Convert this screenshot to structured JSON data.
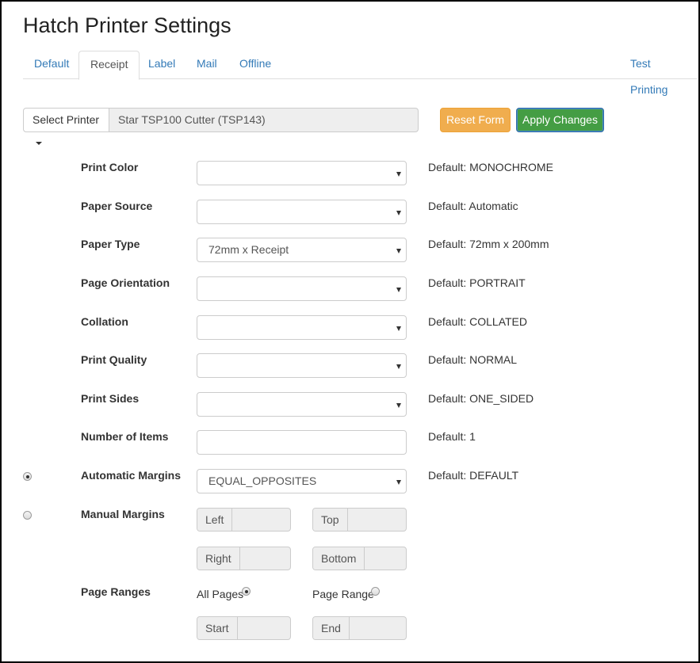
{
  "title": "Hatch Printer Settings",
  "tabs": [
    {
      "label": "Default"
    },
    {
      "label": "Receipt"
    },
    {
      "label": "Label"
    },
    {
      "label": "Mail"
    },
    {
      "label": "Offline"
    }
  ],
  "test_printing": "Test Printing",
  "active_tab": "Receipt",
  "printer": {
    "select_label": "Select Printer",
    "name": "Star TSP100 Cutter (TSP143)"
  },
  "buttons": {
    "reset": "Reset Form",
    "apply": "Apply Changes"
  },
  "fields": {
    "print_color": {
      "label": "Print Color",
      "value": "",
      "default": "Default: MONOCHROME"
    },
    "paper_source": {
      "label": "Paper Source",
      "value": "",
      "default": "Default: Automatic"
    },
    "paper_type": {
      "label": "Paper Type",
      "value": "72mm x Receipt",
      "default": "Default: 72mm x 200mm"
    },
    "page_orientation": {
      "label": "Page Orientation",
      "value": "",
      "default": "Default: PORTRAIT"
    },
    "collation": {
      "label": "Collation",
      "value": "",
      "default": "Default: COLLATED"
    },
    "print_quality": {
      "label": "Print Quality",
      "value": "",
      "default": "Default: NORMAL"
    },
    "print_sides": {
      "label": "Print Sides",
      "value": "",
      "default": "Default: ONE_SIDED"
    },
    "number_of_items": {
      "label": "Number of Items",
      "value": "",
      "default": "Default: 1"
    },
    "automatic_margins": {
      "label": "Automatic Margins",
      "value": "EQUAL_OPPOSITES",
      "default": "Default: DEFAULT",
      "selected": true
    },
    "manual_margins": {
      "label": "Manual Margins",
      "selected": false,
      "left": "Left",
      "top": "Top",
      "right": "Right",
      "bottom": "Bottom"
    },
    "page_ranges": {
      "label": "Page Ranges",
      "all_pages": "All Pages",
      "page_range": "Page Range",
      "all_pages_selected": true,
      "start": "Start",
      "end": "End"
    }
  },
  "colors": {
    "link": "#337ab7",
    "warning": "#f0ad4e",
    "success": "#449d44"
  }
}
